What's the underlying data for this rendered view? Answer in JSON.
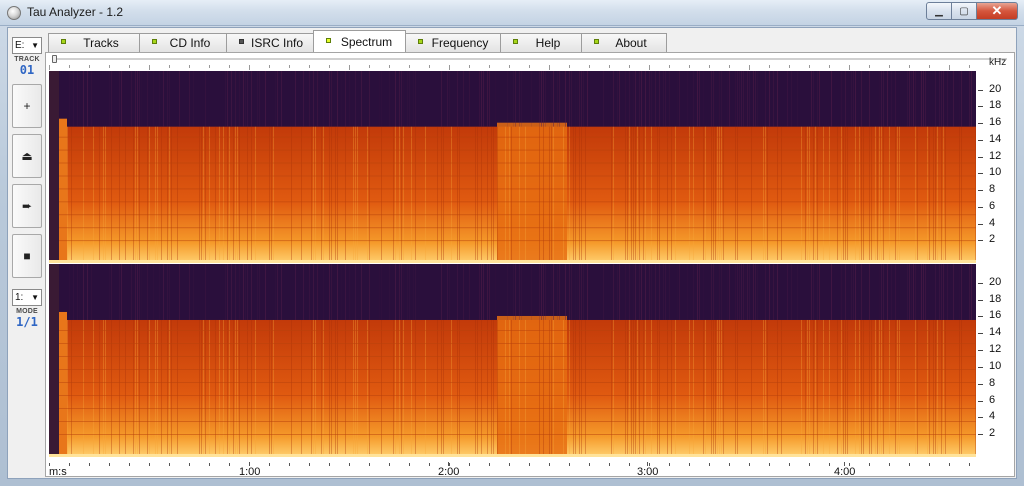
{
  "window": {
    "title": "Tau Analyzer - 1.2",
    "minimize_glyph": "▁",
    "maximize_glyph": "▢",
    "close_glyph": "✕"
  },
  "sidebar": {
    "drive_combo": "E:",
    "track_label": "TRACK",
    "track_value": "01",
    "buttons": [
      {
        "name": "add-button",
        "glyph": "+"
      },
      {
        "name": "eject-button",
        "glyph": "⏏"
      },
      {
        "name": "next-button",
        "glyph": "➨"
      },
      {
        "name": "stop-button",
        "glyph": "■"
      }
    ],
    "mode_combo": "1:",
    "mode_label": "MODE",
    "mode_value": "1/1"
  },
  "tabs": [
    {
      "label": "Tracks",
      "active": false,
      "led": "green"
    },
    {
      "label": "CD Info",
      "active": false,
      "led": "green"
    },
    {
      "label": "ISRC Info",
      "active": false,
      "led": "dark"
    },
    {
      "label": "Spectrum",
      "active": true,
      "led": "yellow"
    },
    {
      "label": "Frequency",
      "active": false,
      "led": "green"
    },
    {
      "label": "Help",
      "active": false,
      "led": "green"
    },
    {
      "label": "About",
      "active": false,
      "led": "green"
    }
  ],
  "spectrum": {
    "unit_label": "kHz",
    "freq_labels": [
      "20",
      "18",
      "16",
      "14",
      "12",
      "10",
      "8",
      "6",
      "4",
      "2"
    ],
    "time_unit": "m:s",
    "time_labels": [
      "1:00",
      "2:00",
      "3:00",
      "4:00"
    ],
    "colors": {
      "background": "#2a0f3c",
      "low": "#c23a0a",
      "mid": "#e05a10",
      "high": "#f59a2a",
      "cutoff": "#3a1240"
    }
  }
}
